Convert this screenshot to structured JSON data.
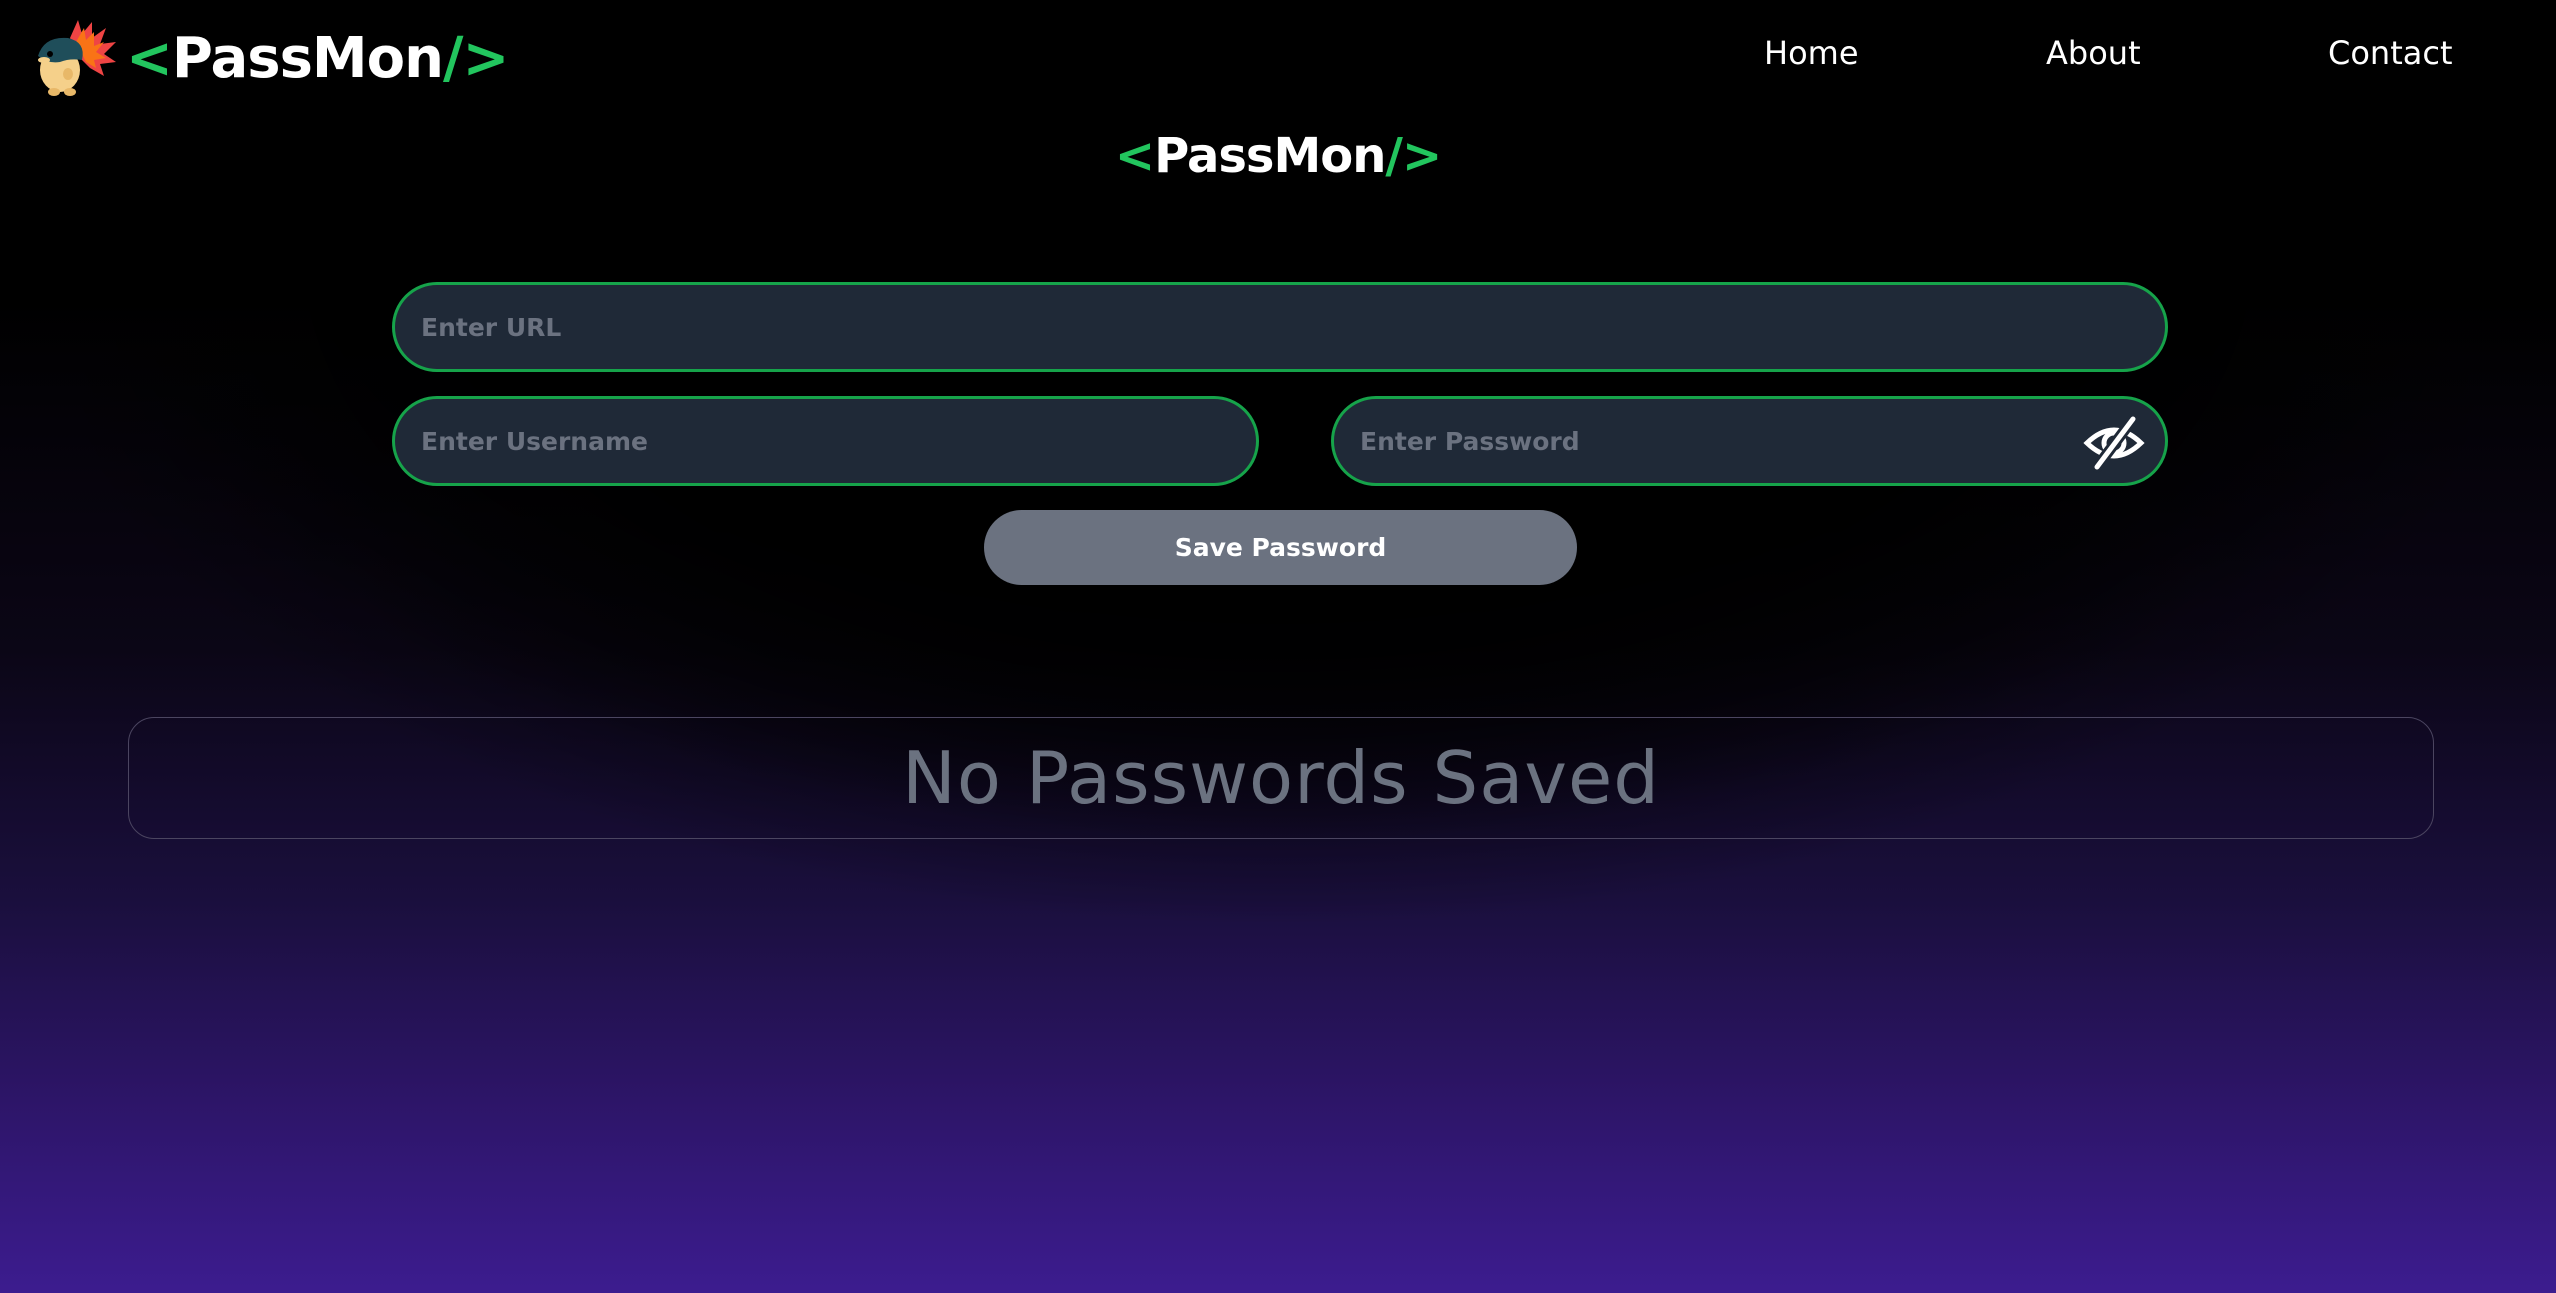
{
  "brand": {
    "logo_open": "<",
    "logo_name": "PassMon",
    "logo_slash": "/",
    "logo_close": ">"
  },
  "nav": {
    "home": "Home",
    "about": "About",
    "contact": "Contact"
  },
  "heading": {
    "logo_open": "<",
    "logo_name": "PassMon",
    "logo_slash": "/",
    "logo_close": ">"
  },
  "form": {
    "url_placeholder": "Enter URL",
    "username_placeholder": "Enter Username",
    "password_placeholder": "Enter Password",
    "toggle_icon": "eye-slash-icon",
    "save_label": "Save Password"
  },
  "list": {
    "empty_message": "No Passwords Saved"
  },
  "colors": {
    "accent": "#22c55e",
    "field_bg": "#1f2937",
    "field_border": "#16a34a",
    "button_bg": "#6b7280",
    "muted_text": "#6b7280",
    "gradient_bottom": "#3c1c8f"
  }
}
